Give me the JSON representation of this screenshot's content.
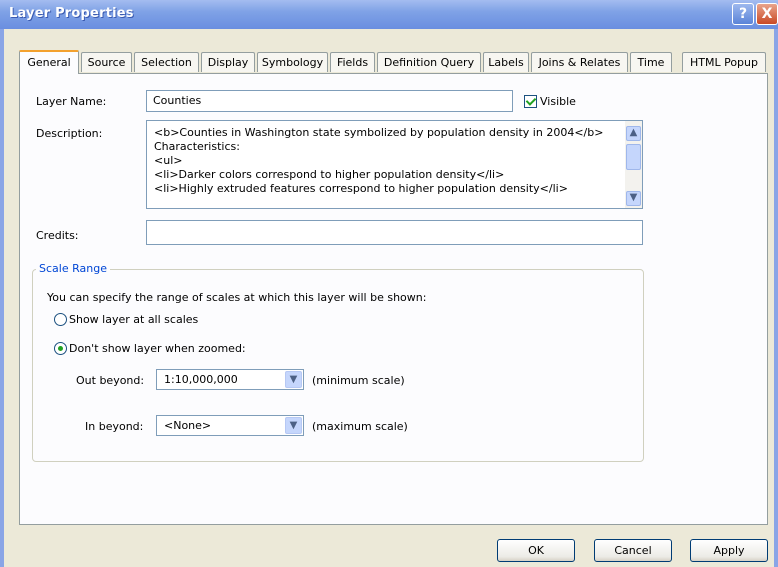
{
  "window": {
    "title": "Layer Properties",
    "help": "?",
    "close": "X"
  },
  "tabs": [
    {
      "label": "General"
    },
    {
      "label": "Source"
    },
    {
      "label": "Selection"
    },
    {
      "label": "Display"
    },
    {
      "label": "Symbology"
    },
    {
      "label": "Fields"
    },
    {
      "label": "Definition Query"
    },
    {
      "label": "Labels"
    },
    {
      "label": "Joins & Relates"
    },
    {
      "label": "Time"
    },
    {
      "label": "HTML Popup"
    }
  ],
  "general": {
    "layer_name_label": "Layer Name:",
    "layer_name_value": "Counties",
    "visible_label": "Visible",
    "visible_checked": true,
    "description_label": "Description:",
    "description_lines": [
      "<b>Counties in Washington state symbolized by population density in 2004</b>",
      "Characteristics:",
      "<ul>",
      "<li>Darker colors correspond to higher population density</li>",
      "<li>Highly extruded features correspond to higher population density</li>"
    ],
    "credits_label": "Credits:",
    "credits_value": ""
  },
  "scale_range": {
    "title": "Scale Range",
    "intro": "You can specify the range of scales at which this layer will be shown:",
    "option_all": "Show layer at all scales",
    "option_zoomed": "Don't show layer when zoomed:",
    "selected_option": "zoomed",
    "out_beyond_label": "Out beyond:",
    "out_beyond_value": "1:10,000,000",
    "out_beyond_hint": "(minimum scale)",
    "in_beyond_label": "In beyond:",
    "in_beyond_value": "<None>",
    "in_beyond_hint": "(maximum scale)"
  },
  "buttons": {
    "ok": "OK",
    "cancel": "Cancel",
    "apply": "Apply"
  },
  "colors": {
    "title_bar": "#7fa2e6",
    "active_tab_accent": "#f3a12e",
    "group_title": "#0046d5",
    "dialog_bg": "#ece9d8"
  }
}
